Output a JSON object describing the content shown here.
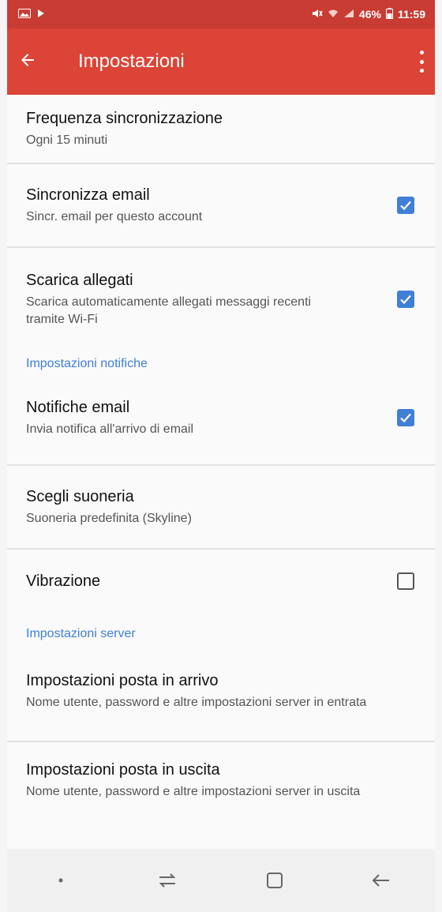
{
  "status_bar": {
    "battery": "46%",
    "time": "11:59",
    "left_icons": [
      "image-icon",
      "play-icon"
    ],
    "right_icons": [
      "mute-icon",
      "wifi-icon",
      "signal-icon",
      "battery-icon"
    ]
  },
  "app_bar": {
    "title": "Impostazioni",
    "back_icon": "arrow-left-icon",
    "menu_icon": "more-vert-icon",
    "color": "#db4437"
  },
  "settings": {
    "sync_frequency": {
      "title": "Frequenza sincronizzazione",
      "subtitle": "Ogni 15 minuti"
    },
    "sync_email": {
      "title": "Sincronizza email",
      "subtitle": "Sincr. email per questo account",
      "checked": true
    },
    "download_attachments": {
      "title": "Scarica allegati",
      "subtitle": "Scarica automaticamente allegati messaggi recenti tramite Wi-Fi",
      "checked": true
    },
    "section_notifications": "Impostazioni notifiche",
    "email_notifications": {
      "title": "Notifiche email",
      "subtitle": "Invia notifica all'arrivo di email",
      "checked": true
    },
    "ringtone": {
      "title": "Scegli suoneria",
      "subtitle": "Suoneria predefinita (Skyline)"
    },
    "vibration": {
      "title": "Vibrazione",
      "checked": false
    },
    "section_server": "Impostazioni server",
    "incoming_server": {
      "title": "Impostazioni posta in arrivo",
      "subtitle": "Nome utente, password e altre impostazioni server in entrata"
    },
    "outgoing_server": {
      "title": "Impostazioni posta in uscita",
      "subtitle": "Nome utente, password e altre impostazioni server in uscita"
    }
  },
  "nav_bar": {
    "icons": [
      "dot-icon",
      "recent-apps-icon",
      "home-icon",
      "back-icon"
    ]
  },
  "accent_color": "#3f7fd6"
}
